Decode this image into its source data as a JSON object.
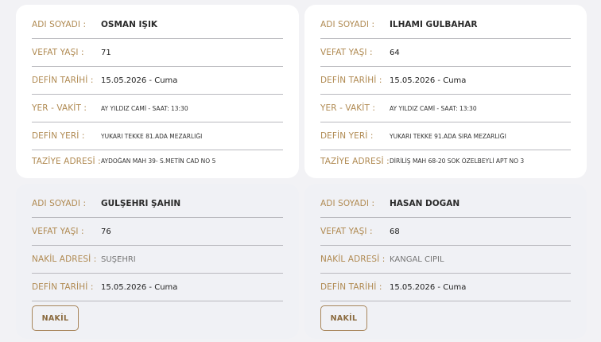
{
  "labels": {
    "name": "ADI SOYADI :",
    "age": "VEFAT YAŞI :",
    "date": "DEFİN TARİHİ :",
    "time": "YER - VAKİT :",
    "place": "DEFİN YERİ :",
    "condolence": "TAZİYE ADRESİ :",
    "transfer": "NAKİL ADRESİ :"
  },
  "cards": [
    {
      "name": "OSMAN IŞIK",
      "age": "71",
      "date": "15.05.2026 - Cuma",
      "time": "AY YILDIZ CAMİ - SAAT: 13:30",
      "place": "YUKARI TEKKE 81.ADA MEZARLIĞI",
      "condolence": "AYDOĞAN MAH 39- S.METİN CAD NO 5"
    },
    {
      "name": "İLHAMİ GÜLBAHAR",
      "age": "64",
      "date": "15.05.2026 - Cuma",
      "time": "AY YILDIZ CAMİ - SAAT: 13:30",
      "place": "YUKARI TEKKE 91.ADA SIRA MEZARLIĞI",
      "condolence": "DİRİLİŞ MAH 68-20 SOK ÖZELBEYLİ APT NO 3"
    },
    {
      "name": "GÜLŞEHRİ ŞAHİN",
      "age": "76",
      "transfer": "SUŞEHRİ",
      "date": "15.05.2026 - Cuma",
      "button": "NAKİL"
    },
    {
      "name": "HASAN DOĞAN",
      "age": "68",
      "transfer": "KANGAL CİPİL",
      "date": "15.05.2026 - Cuma",
      "button": "NAKİL"
    }
  ]
}
